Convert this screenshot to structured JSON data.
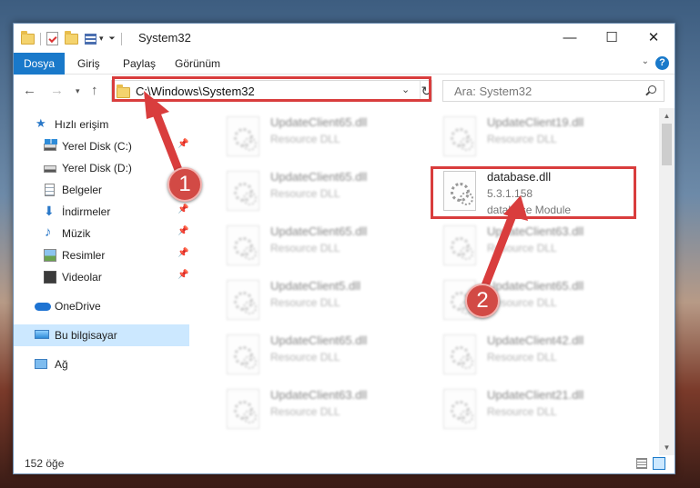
{
  "window": {
    "title": "System32",
    "controls": {
      "minimize": "—",
      "maximize": "☐",
      "close": "✕"
    }
  },
  "ribbon": {
    "tabs": [
      "Dosya",
      "Giriş",
      "Paylaş",
      "Görünüm"
    ],
    "help": "?"
  },
  "address": {
    "path": "C:\\Windows\\System32",
    "refresh": "↻"
  },
  "search": {
    "placeholder": "Ara: System32"
  },
  "nav": {
    "quick_access": "Hızlı erişim",
    "items": [
      {
        "label": "Yerel Disk (C:)",
        "icon": "drive-c-icon"
      },
      {
        "label": "Yerel Disk (D:)",
        "icon": "drive-d-icon"
      },
      {
        "label": "Belgeler",
        "icon": "documents-icon"
      },
      {
        "label": "İndirmeler",
        "icon": "downloads-icon"
      },
      {
        "label": "Müzik",
        "icon": "music-icon"
      },
      {
        "label": "Resimler",
        "icon": "pictures-icon"
      },
      {
        "label": "Videolar",
        "icon": "videos-icon"
      }
    ],
    "onedrive": "OneDrive",
    "this_pc": "Bu bilgisayar",
    "network": "Ağ"
  },
  "files": {
    "left": [
      {
        "name": "UpdateClient65.dll",
        "type": "Resource DLL"
      },
      {
        "name": "UpdateClient65.dll",
        "type": "Resource DLL"
      },
      {
        "name": "UpdateClient65.dll",
        "type": "Resource DLL"
      },
      {
        "name": "UpdateClient5.dll",
        "type": "Resource DLL"
      },
      {
        "name": "UpdateClient65.dll",
        "type": "Resource DLL"
      },
      {
        "name": "UpdateClient63.dll",
        "type": "Resource DLL"
      }
    ],
    "right": [
      {
        "name": "UpdateClient19.dll",
        "type": "Resource DLL"
      },
      {
        "name": "UpdateClient63.dll",
        "type": "Resource DLL"
      },
      {
        "name": "UpdateClient65.dll",
        "type": "Resource DLL"
      },
      {
        "name": "UpdateClient42.dll",
        "type": "Resource DLL"
      },
      {
        "name": "UpdateClient21.dll",
        "type": "Resource DLL"
      }
    ],
    "highlighted": {
      "name": "database.dll",
      "version": "5.3.1.158",
      "description": "database Module"
    }
  },
  "status": {
    "count": "152 öğe"
  },
  "annotations": {
    "step1": "1",
    "step2": "2",
    "color": "#d93d3d"
  }
}
